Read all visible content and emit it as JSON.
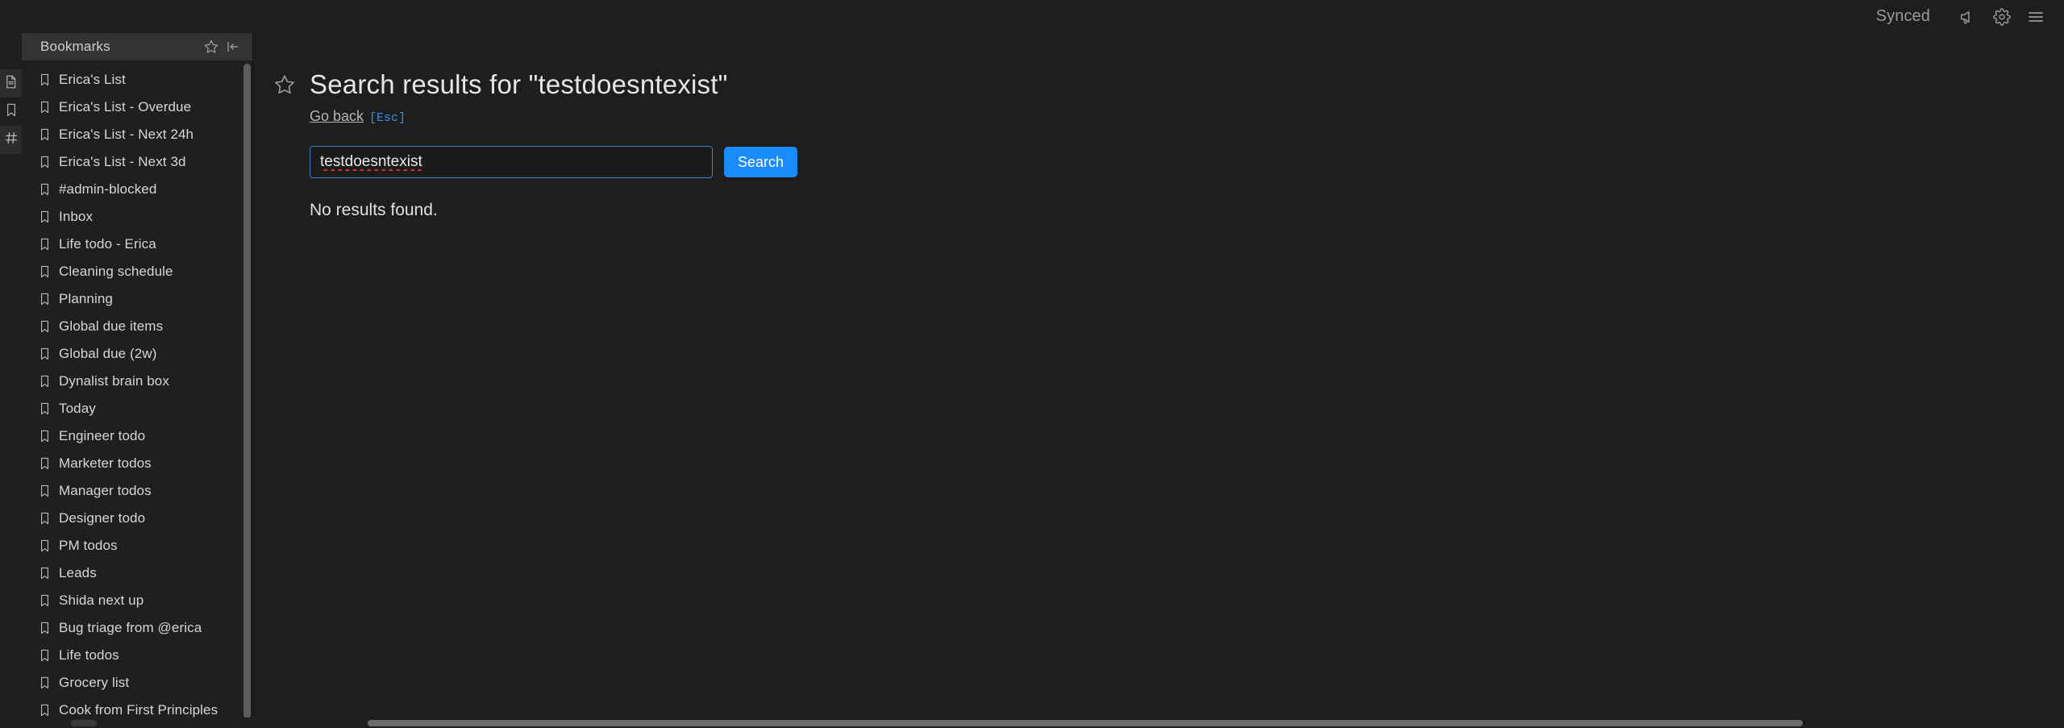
{
  "topbar": {
    "sync_status": "Synced",
    "icons": [
      {
        "name": "megaphone-icon"
      },
      {
        "name": "gear-icon"
      },
      {
        "name": "hamburger-menu-icon"
      }
    ]
  },
  "rail": {
    "items": [
      {
        "name": "document-icon",
        "active": true
      },
      {
        "name": "bookmark-icon",
        "active": false
      },
      {
        "name": "hash-tag-icon",
        "active": true
      }
    ]
  },
  "sidebar": {
    "title": "Bookmarks",
    "header_icons": [
      {
        "name": "star-icon"
      },
      {
        "name": "collapse-panel-icon"
      }
    ],
    "items": [
      {
        "label": "Erica's List"
      },
      {
        "label": "Erica's List - Overdue"
      },
      {
        "label": "Erica's List - Next 24h"
      },
      {
        "label": "Erica's List - Next 3d"
      },
      {
        "label": "#admin-blocked"
      },
      {
        "label": "Inbox"
      },
      {
        "label": "Life todo - Erica"
      },
      {
        "label": "Cleaning schedule"
      },
      {
        "label": "Planning"
      },
      {
        "label": "Global due items"
      },
      {
        "label": "Global due (2w)"
      },
      {
        "label": "Dynalist brain box"
      },
      {
        "label": "Today"
      },
      {
        "label": "Engineer todo"
      },
      {
        "label": "Marketer todos"
      },
      {
        "label": "Manager todos"
      },
      {
        "label": "Designer todo"
      },
      {
        "label": "PM todos"
      },
      {
        "label": "Leads"
      },
      {
        "label": "Shida next up"
      },
      {
        "label": "Bug triage from @erica"
      },
      {
        "label": "Life todos"
      },
      {
        "label": "Grocery list"
      },
      {
        "label": "Cook from First Principles"
      }
    ]
  },
  "main": {
    "page_title": "Search results for \"testdoesntexist\"",
    "star_icon": "star-icon",
    "go_back_label": "Go back",
    "go_back_shortcut": "[Esc]",
    "search_value": "testdoesntexist",
    "search_placeholder": "Search",
    "search_button_label": "Search",
    "empty_state": "No results found."
  },
  "colors": {
    "accent_blue": "#1a8cff",
    "link_blue": "#3b8ede",
    "input_border": "#3d7fc1",
    "spellcheck_red": "#e03030",
    "app_bg": "#1e1e1e",
    "sidebar_bg": "#1f1f1f",
    "sidebar_header_bg": "#333333"
  }
}
